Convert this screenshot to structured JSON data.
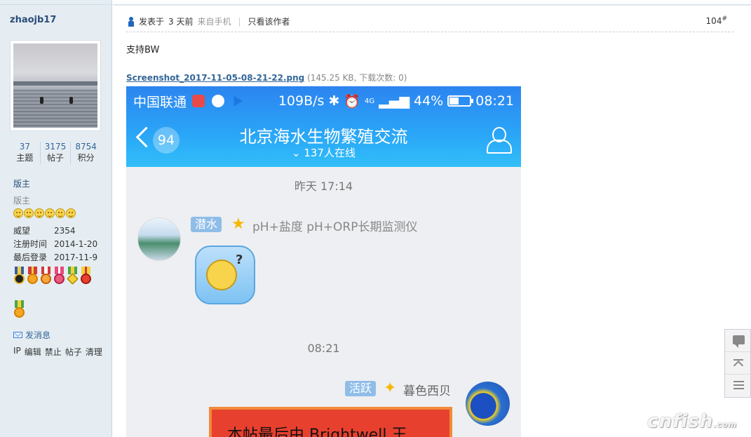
{
  "author": {
    "username": "zhaojb17",
    "stats": [
      {
        "num": "37",
        "label": "主题"
      },
      {
        "num": "3175",
        "label": "帖子"
      },
      {
        "num": "8754",
        "label": "积分"
      }
    ],
    "rank": "版主",
    "rank_sub": "版主",
    "info": [
      {
        "key": "威望",
        "value": "2354"
      },
      {
        "key": "注册时间",
        "value": "2014-1-20"
      },
      {
        "key": "最后登录",
        "value": "2017-11-9"
      }
    ],
    "send_message": "发消息",
    "actions": [
      "IP",
      "编辑",
      "禁止",
      "帖子",
      "清理"
    ]
  },
  "post": {
    "meta_prefix": "发表于",
    "meta_time": "3 天前",
    "meta_source": "来自手机",
    "meta_sep": "|",
    "only_author": "只看该作者",
    "floor": "104",
    "floor_mark": "#",
    "text": "支持BW",
    "attachment_name": "Screenshot_2017-11-05-08-21-22.png",
    "attachment_meta": "(145.25 KB, 下载次数: 0)"
  },
  "phone": {
    "carrier": "中国联通",
    "speed": "109B/s",
    "network": "4G",
    "battery": "44%",
    "clock": "08:21",
    "badge": "94",
    "group_title": "北京海水生物繁殖交流",
    "online": "137人在线",
    "time1": "昨天 17:14",
    "msg1_tag": "潜水",
    "msg1_name": "pH+盐度 pH+ORP长期监测仪",
    "time2": "08:21",
    "msg2_tag": "活跃",
    "msg2_name": "暮色西贝",
    "red_card_text": "本帖最后由 Brightwell 王"
  },
  "watermark": "cnfish",
  "watermark_suffix": ".com",
  "colors": {
    "link": "#336699",
    "sidebar": "#e5edf2",
    "qq_header": "#2aa6f7"
  }
}
